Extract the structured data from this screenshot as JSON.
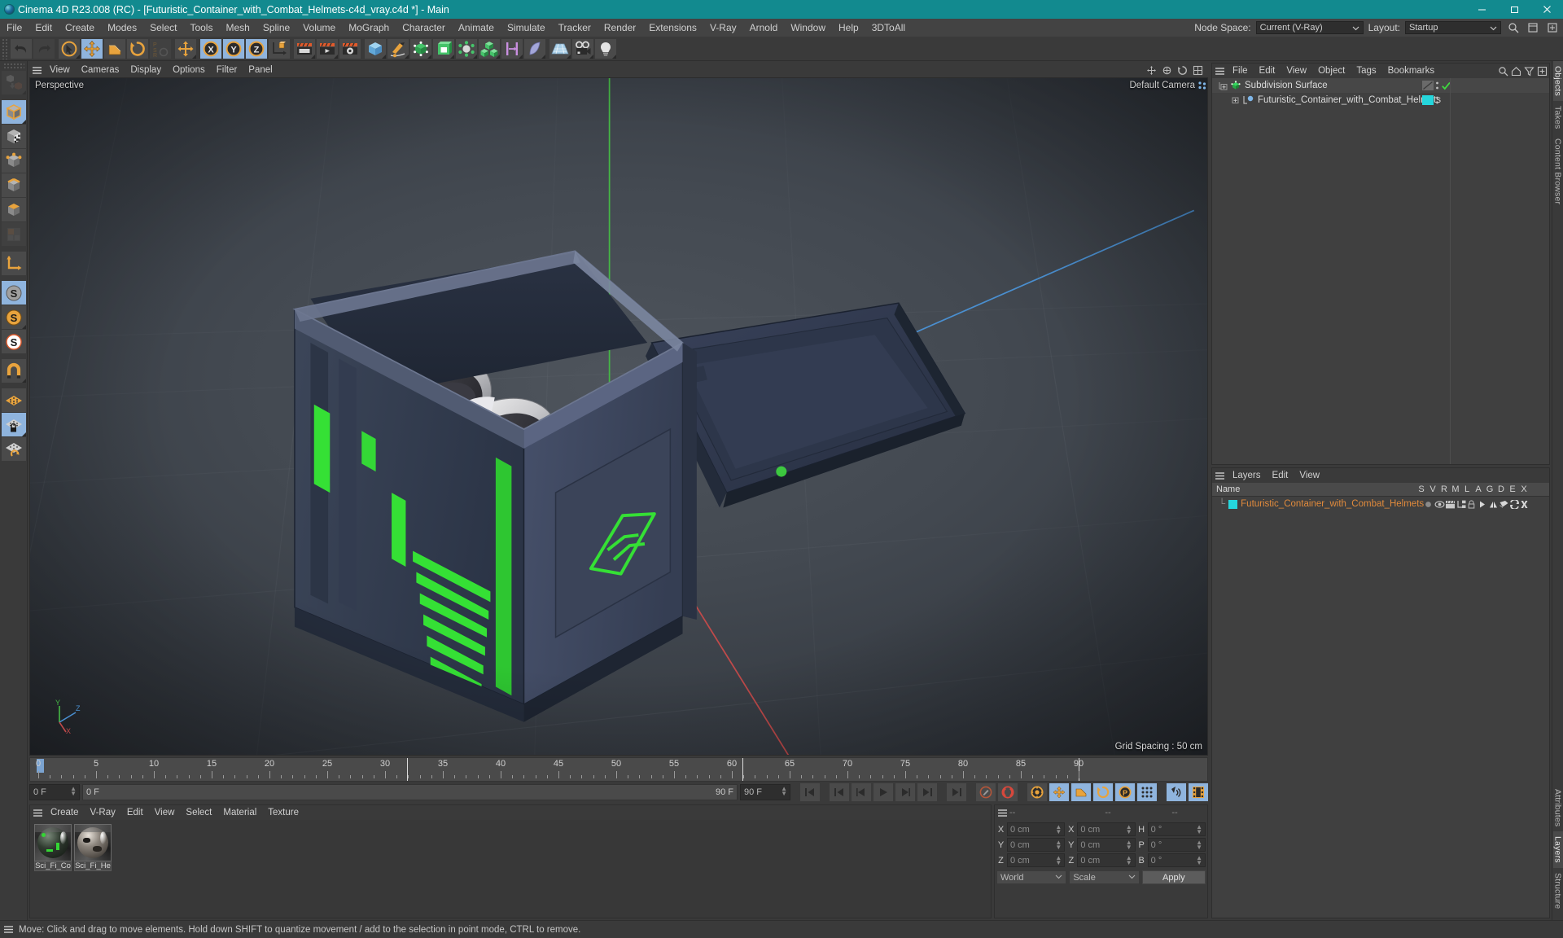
{
  "window": {
    "title": "Cinema 4D R23.008 (RC) - [Futuristic_Container_with_Combat_Helmets-c4d_vray.c4d *] - Main",
    "accent": "#128a8f",
    "minimize": "minimize-icon",
    "maximize": "maximize-icon",
    "close": "close-icon"
  },
  "menubar": {
    "items": [
      "File",
      "Edit",
      "Create",
      "Modes",
      "Select",
      "Tools",
      "Mesh",
      "Spline",
      "Volume",
      "MoGraph",
      "Character",
      "Animate",
      "Simulate",
      "Tracker",
      "Render",
      "Extensions",
      "V-Ray",
      "Arnold",
      "Window",
      "Help",
      "3DToAll"
    ],
    "node_space_label": "Node Space:",
    "node_space_value": "Current (V-Ray)",
    "layout_label": "Layout:",
    "layout_value": "Startup"
  },
  "toolbar": {
    "buttons": [
      {
        "name": "undo-button",
        "label": "Undo"
      },
      {
        "name": "redo-button",
        "label": "Redo"
      },
      {
        "name": "live-selection-tool",
        "label": "Live Selection"
      },
      {
        "name": "move-tool",
        "label": "Move"
      },
      {
        "name": "scale-tool",
        "label": "Scale"
      },
      {
        "name": "rotate-tool",
        "label": "Rotate"
      },
      {
        "name": "psr-lock-button",
        "label": "PSR"
      },
      {
        "name": "world-object-axis-button",
        "label": "World/Object Axis"
      },
      {
        "name": "x-axis-lock-button",
        "label": "X"
      },
      {
        "name": "y-axis-lock-button",
        "label": "Y"
      },
      {
        "name": "z-axis-lock-button",
        "label": "Z"
      },
      {
        "name": "coordinate-system-button",
        "label": "Coordinate System"
      },
      {
        "name": "render-view-button",
        "label": "Render View"
      },
      {
        "name": "render-to-picture-viewer-button",
        "label": "Render to Picture Viewer"
      },
      {
        "name": "render-settings-button",
        "label": "Render Settings"
      },
      {
        "name": "cube-primitive-button",
        "label": "Cube"
      },
      {
        "name": "pen-spline-button",
        "label": "Pen"
      },
      {
        "name": "subdivision-surface-button",
        "label": "Subdivision Surface"
      },
      {
        "name": "array-generator-button",
        "label": "Array"
      },
      {
        "name": "deformer-button",
        "label": "Bend"
      },
      {
        "name": "mograph-cloner-button",
        "label": "Cloner"
      },
      {
        "name": "scene-nodes-button",
        "label": "Scene Nodes"
      },
      {
        "name": "field-button",
        "label": "Field"
      },
      {
        "name": "floor-button",
        "label": "Floor"
      },
      {
        "name": "camera-button",
        "label": "Camera"
      },
      {
        "name": "light-button",
        "label": "Light"
      }
    ]
  },
  "lefttools": {
    "buttons": [
      {
        "name": "make-editable-button",
        "label": "Make Editable",
        "state": "disabled"
      },
      {
        "name": "model-mode-button",
        "label": "Model Mode",
        "state": "active"
      },
      {
        "name": "texture-mode-button",
        "label": "Texture Mode",
        "state": "normal"
      },
      {
        "name": "points-mode-button",
        "label": "Points",
        "state": "normal"
      },
      {
        "name": "edges-mode-button",
        "label": "Edges",
        "state": "normal"
      },
      {
        "name": "polygons-mode-button",
        "label": "Polygons",
        "state": "normal"
      },
      {
        "name": "uv-mode-button",
        "label": "UV Polygons",
        "state": "disabled"
      },
      {
        "name": "axis-mode-button",
        "label": "Enable Axis",
        "state": "normal"
      },
      {
        "name": "viewport-solo-off-button",
        "label": "Viewport Solo Off",
        "state": "active"
      },
      {
        "name": "viewport-solo-single-button",
        "label": "Viewport Solo Single",
        "state": "normal"
      },
      {
        "name": "viewport-solo-hierarchy-button",
        "label": "Viewport Solo Hierarchy",
        "state": "normal"
      },
      {
        "name": "snap-button",
        "label": "Enable Snapping",
        "state": "normal"
      },
      {
        "name": "workplane-button",
        "label": "Workplane",
        "state": "normal"
      },
      {
        "name": "lock-workplane-button",
        "label": "Lock Workplane",
        "state": "active"
      },
      {
        "name": "planar-workplane-button",
        "label": "Planar Workplane",
        "state": "normal"
      }
    ]
  },
  "viewport": {
    "menu": [
      "View",
      "Cameras",
      "Display",
      "Options",
      "Filter",
      "Panel"
    ],
    "projection_label": "Perspective",
    "camera_label": "Default Camera",
    "grid_spacing": "Grid Spacing : 50 cm",
    "axis_x": "X",
    "axis_y": "Y",
    "axis_z": "Z",
    "bg_color": "#454b53",
    "axis_x_color": "#c85050",
    "axis_y_color": "#4ec04e",
    "axis_z_color": "#4a8fd0"
  },
  "timeline": {
    "ticks": [
      0,
      5,
      10,
      15,
      20,
      25,
      30,
      35,
      40,
      45,
      50,
      55,
      60,
      65,
      70,
      75,
      80,
      85,
      90
    ],
    "current_frame": "0 F",
    "range_start": "0 F",
    "range_end": "90 F",
    "preview_min": "0 F",
    "preview_max": "90 F",
    "end_frame_field": "90 F",
    "transport": [
      {
        "name": "go-to-start-button",
        "label": "Go to Start"
      },
      {
        "name": "go-to-previous-key-button",
        "label": "Go to Previous Key"
      },
      {
        "name": "go-to-previous-frame-button",
        "label": "Go to Previous Frame"
      },
      {
        "name": "play-button",
        "label": "Play"
      },
      {
        "name": "go-to-next-frame-button",
        "label": "Go to Next Frame"
      },
      {
        "name": "go-to-next-key-button",
        "label": "Go to Next Key"
      },
      {
        "name": "go-to-end-button",
        "label": "Go to End"
      },
      {
        "name": "record-active-objects-button",
        "label": "Record Active Objects"
      },
      {
        "name": "autokeying-button",
        "label": "Autokeying"
      },
      {
        "name": "keyframe-settings-button",
        "label": "Keyframe Selection"
      },
      {
        "name": "position-key-button",
        "label": "Position"
      },
      {
        "name": "scale-key-button",
        "label": "Scale"
      },
      {
        "name": "rotation-key-button",
        "label": "Rotation"
      },
      {
        "name": "param-key-button",
        "label": "Parameter"
      },
      {
        "name": "pla-key-button",
        "label": "Point Level Animation"
      },
      {
        "name": "sound-button",
        "label": "Sound"
      },
      {
        "name": "film-button",
        "label": "Preview Range"
      }
    ]
  },
  "material_manager": {
    "menu": [
      "Create",
      "V-Ray",
      "Edit",
      "View",
      "Select",
      "Material",
      "Texture"
    ],
    "materials": [
      {
        "name": "Sci_Fi_Co",
        "full": "Sci_Fi_Container",
        "color": "#2e3a2e",
        "accent": "#34d634"
      },
      {
        "name": "Sci_Fi_He",
        "full": "Sci_Fi_Helmet",
        "color": "#5d5751",
        "accent": "#e8e2da"
      }
    ]
  },
  "coordinates": {
    "header": [
      "--",
      "--",
      "--"
    ],
    "rows": [
      {
        "pos_label": "X",
        "pos_value": "0 cm",
        "size_label": "X",
        "size_value": "0 cm",
        "rot_label": "H",
        "rot_value": "0 °"
      },
      {
        "pos_label": "Y",
        "pos_value": "0 cm",
        "size_label": "Y",
        "size_value": "0 cm",
        "rot_label": "P",
        "rot_value": "0 °"
      },
      {
        "pos_label": "Z",
        "pos_value": "0 cm",
        "size_label": "Z",
        "size_value": "0 cm",
        "rot_label": "B",
        "rot_value": "0 °"
      }
    ],
    "system": "World",
    "mode": "Scale",
    "apply": "Apply"
  },
  "object_manager": {
    "menu": [
      "File",
      "Edit",
      "View",
      "Object",
      "Tags",
      "Bookmarks"
    ],
    "rows": [
      {
        "name": "Subdivision Surface",
        "depth": 0,
        "icon": "subdivision-surface-icon",
        "tag_color": "#6a6a6a",
        "check": true
      },
      {
        "name": "Futuristic_Container_with_Combat_Helmets",
        "depth": 1,
        "icon": "polygon-object-icon",
        "tag_color": "#25d6dc",
        "check": false
      }
    ]
  },
  "layer_manager": {
    "menu": [
      "Layers",
      "Edit",
      "View"
    ],
    "columns": [
      "S",
      "V",
      "R",
      "M",
      "L",
      "A",
      "G",
      "D",
      "E",
      "X"
    ],
    "name_header": "Name",
    "rows": [
      {
        "name": "Futuristic_Container_with_Combat_Helmets",
        "color": "#25d6dc"
      }
    ]
  },
  "right_rail": {
    "tabs": [
      "Objects",
      "Takes",
      "Content Browser"
    ],
    "tabs_lower": [
      "Attributes",
      "Layers",
      "Structure"
    ]
  },
  "statusbar": {
    "message": "Move: Click and drag to move elements. Hold down SHIFT to quantize movement / add to the selection in point mode, CTRL to remove."
  }
}
